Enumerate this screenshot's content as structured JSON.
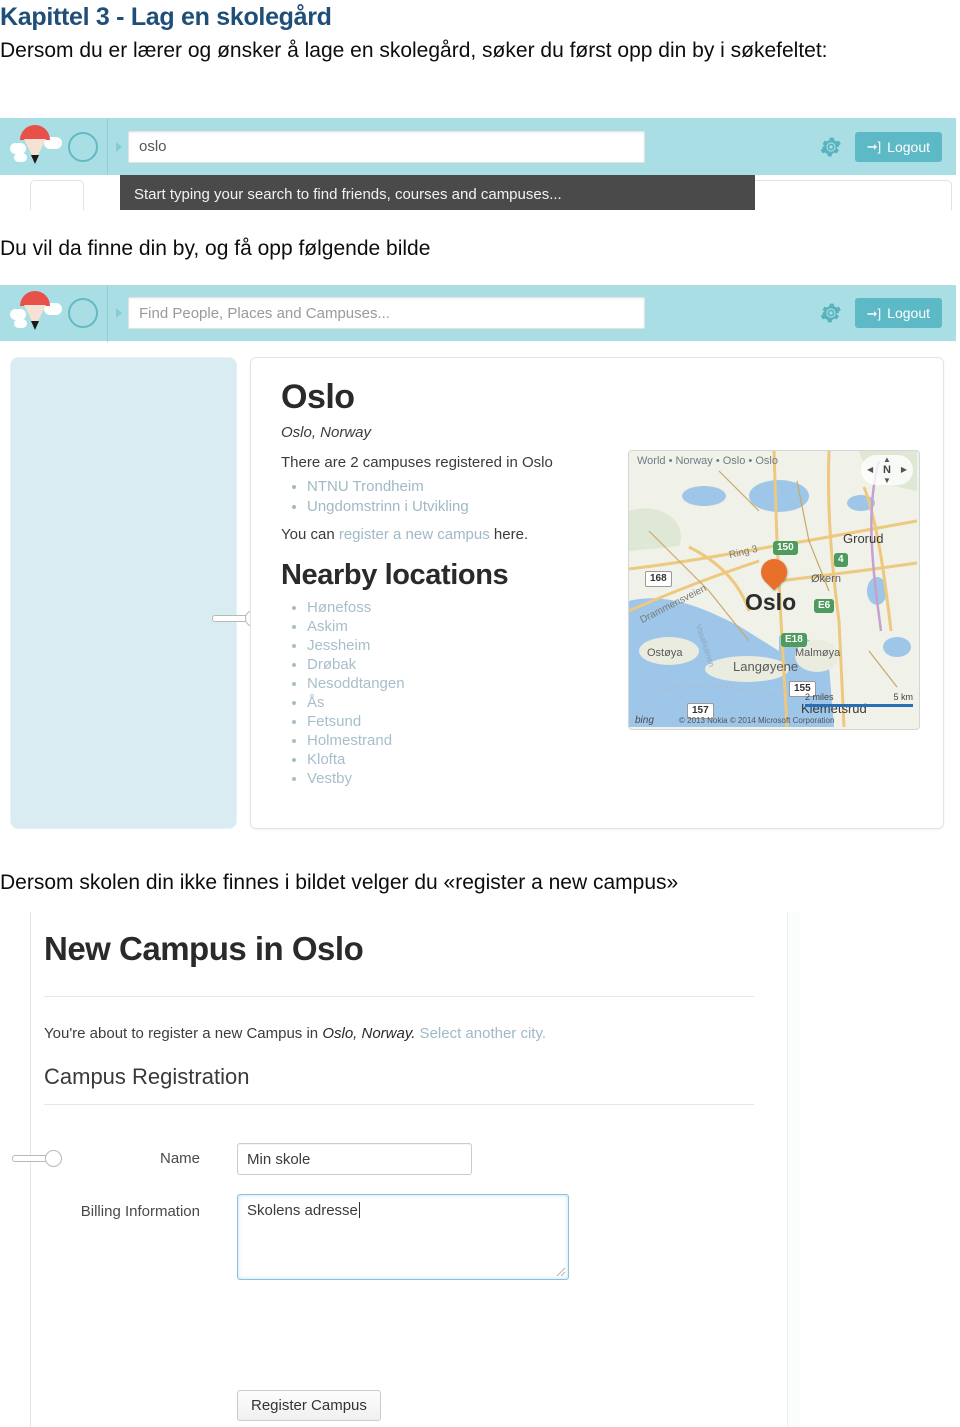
{
  "document": {
    "title": "Kapittel 3 - Lag en skolegård",
    "paragraph1": "Dersom du er lærer og ønsker å lage en skolegård, søker du først opp din by i søkefeltet:",
    "paragraph2": "Du vil da finne din by, og få opp følgende bilde",
    "paragraph3": "Dersom skolen din ikke finnes i bildet velger du «register a new campus»",
    "title_color": "#1f4e79"
  },
  "screenshot1": {
    "header": {
      "logo_alt": "pencil-cloud-logo",
      "search_value": "oslo",
      "gear_label": "settings",
      "logout_label": "Logout",
      "background": "#a9dee4",
      "logout_color": "#5cb9c5"
    },
    "tooltip": "Start typing your search to find friends, courses and campuses..."
  },
  "screenshot2": {
    "header": {
      "logo_alt": "pencil-cloud-logo",
      "search_placeholder": "Find People, Places and Campuses...",
      "gear_label": "settings",
      "logout_label": "Logout"
    },
    "city": {
      "name": "Oslo",
      "subtitle": "Oslo, Norway",
      "campus_count_line": "There are 2 campuses registered in Oslo",
      "campuses": [
        "NTNU Trondheim",
        "Ungdomstrinn i Utvikling"
      ],
      "register_prefix": "You can ",
      "register_link": "register a new campus",
      "register_suffix": " here."
    },
    "nearby": {
      "heading": "Nearby locations",
      "items": [
        "Hønefoss",
        "Askim",
        "Jessheim",
        "Drøbak",
        "Nesoddtangen",
        "Ås",
        "Fetsund",
        "Holmestrand",
        "Klofta",
        "Vestby"
      ]
    },
    "map": {
      "breadcrumb": "World • Norway • Oslo • Oslo",
      "compass": "N",
      "center_label": "Oslo",
      "labels": [
        "Grorud",
        "Økern",
        "Ostøya",
        "Langøyene",
        "Malmøya",
        "Klemetsrud"
      ],
      "roads": [
        "Ring 3",
        "Drammensveien",
        "Vasøholmen"
      ],
      "shields_green": [
        "150",
        "4",
        "E6",
        "E18"
      ],
      "shields_white": [
        "168",
        "155",
        "157"
      ],
      "scale_miles": "2 miles",
      "scale_km": "5 km",
      "attribution": "© 2013 Nokia  © 2014 Microsoft Corporation",
      "provider": "bing",
      "pin_color": "#e8702a"
    }
  },
  "screenshot3": {
    "title": "New Campus in Oslo",
    "lead_prefix": "You're about to register a new Campus in ",
    "lead_city": "Oslo, Norway.",
    "lead_link": " Select another city.",
    "section_title": "Campus Registration",
    "fields": [
      {
        "label": "Name",
        "value": "Min skole"
      },
      {
        "label": "Billing Information",
        "value": "Skolens adresse"
      }
    ],
    "submit_label": "Register Campus"
  }
}
